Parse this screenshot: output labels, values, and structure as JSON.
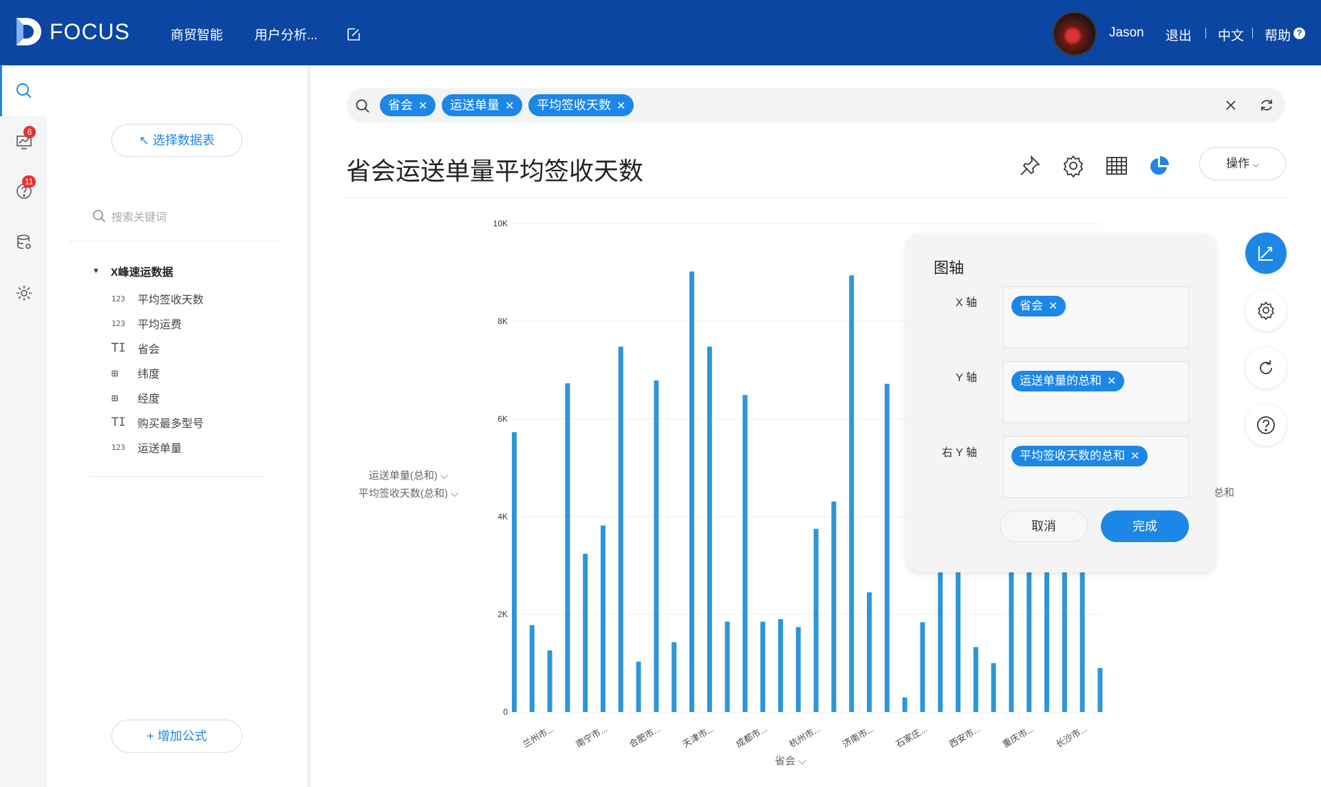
{
  "topbar": {
    "logo_text": "FOCUS",
    "nav": [
      "商贸智能",
      "用户分析..."
    ],
    "user_name": "Jason",
    "logout": "退出",
    "language": "中文",
    "help": "帮助",
    "help_badge": "?"
  },
  "rail": {
    "badges": {
      "dashboard": "6",
      "questions": "11"
    },
    "icons": [
      "search-icon",
      "dashboard-icon",
      "question-icon",
      "database-icon",
      "gear-icon"
    ]
  },
  "panel": {
    "select_table": "↖ 选择数据表",
    "search_placeholder": "搜索关键词",
    "table_name": "X峰速运数据",
    "fields": [
      {
        "icon": "123",
        "name": "平均签收天数"
      },
      {
        "icon": "123",
        "name": "平均运费"
      },
      {
        "icon": "T",
        "name": "省会"
      },
      {
        "icon": "geo",
        "name": "纬度"
      },
      {
        "icon": "geo",
        "name": "经度"
      },
      {
        "icon": "T",
        "name": "购买最多型号"
      },
      {
        "icon": "123",
        "name": "运送单量"
      }
    ],
    "add_formula": "+ 增加公式"
  },
  "query": {
    "chips": [
      "省会",
      "运送单量",
      "平均签收天数"
    ]
  },
  "title": "省会运送单量平均签收天数",
  "operate_label": "操作",
  "legend": {
    "left_axis": [
      "运送单量(总和)",
      "平均签收天数(总和)"
    ],
    "right_fragment": "总和",
    "x_axis_title": "省会"
  },
  "chart_data": {
    "type": "bar",
    "y_ticks": [
      "10K",
      "8K",
      "6K",
      "4K",
      "2K",
      "0"
    ],
    "ylim": [
      0,
      10000
    ],
    "x_tick_labels": [
      "兰州市...",
      "南宁市...",
      "合肥市...",
      "天津市...",
      "成都市...",
      "杭州市...",
      "济南市...",
      "石家庄...",
      "西安市...",
      "重庆市...",
      "长沙市..."
    ],
    "values": [
      5730,
      1780,
      1260,
      6730,
      3240,
      3820,
      7480,
      1030,
      6790,
      1430,
      9020,
      7480,
      1850,
      6490,
      1850,
      1900,
      1740,
      3750,
      4310,
      8940,
      2450,
      6720,
      300,
      1840,
      3000,
      3000,
      1330,
      1000,
      3000,
      3000,
      3000,
      3000,
      3000,
      900
    ]
  },
  "axis_popup": {
    "title": "图轴",
    "x_label": "X 轴",
    "x_chip": "省会",
    "y_label": "Y 轴",
    "y_chip": "运送单量的总和",
    "ry_label": "右 Y 轴",
    "ry_chip": "平均签收天数的总和",
    "cancel": "取消",
    "done": "完成"
  }
}
